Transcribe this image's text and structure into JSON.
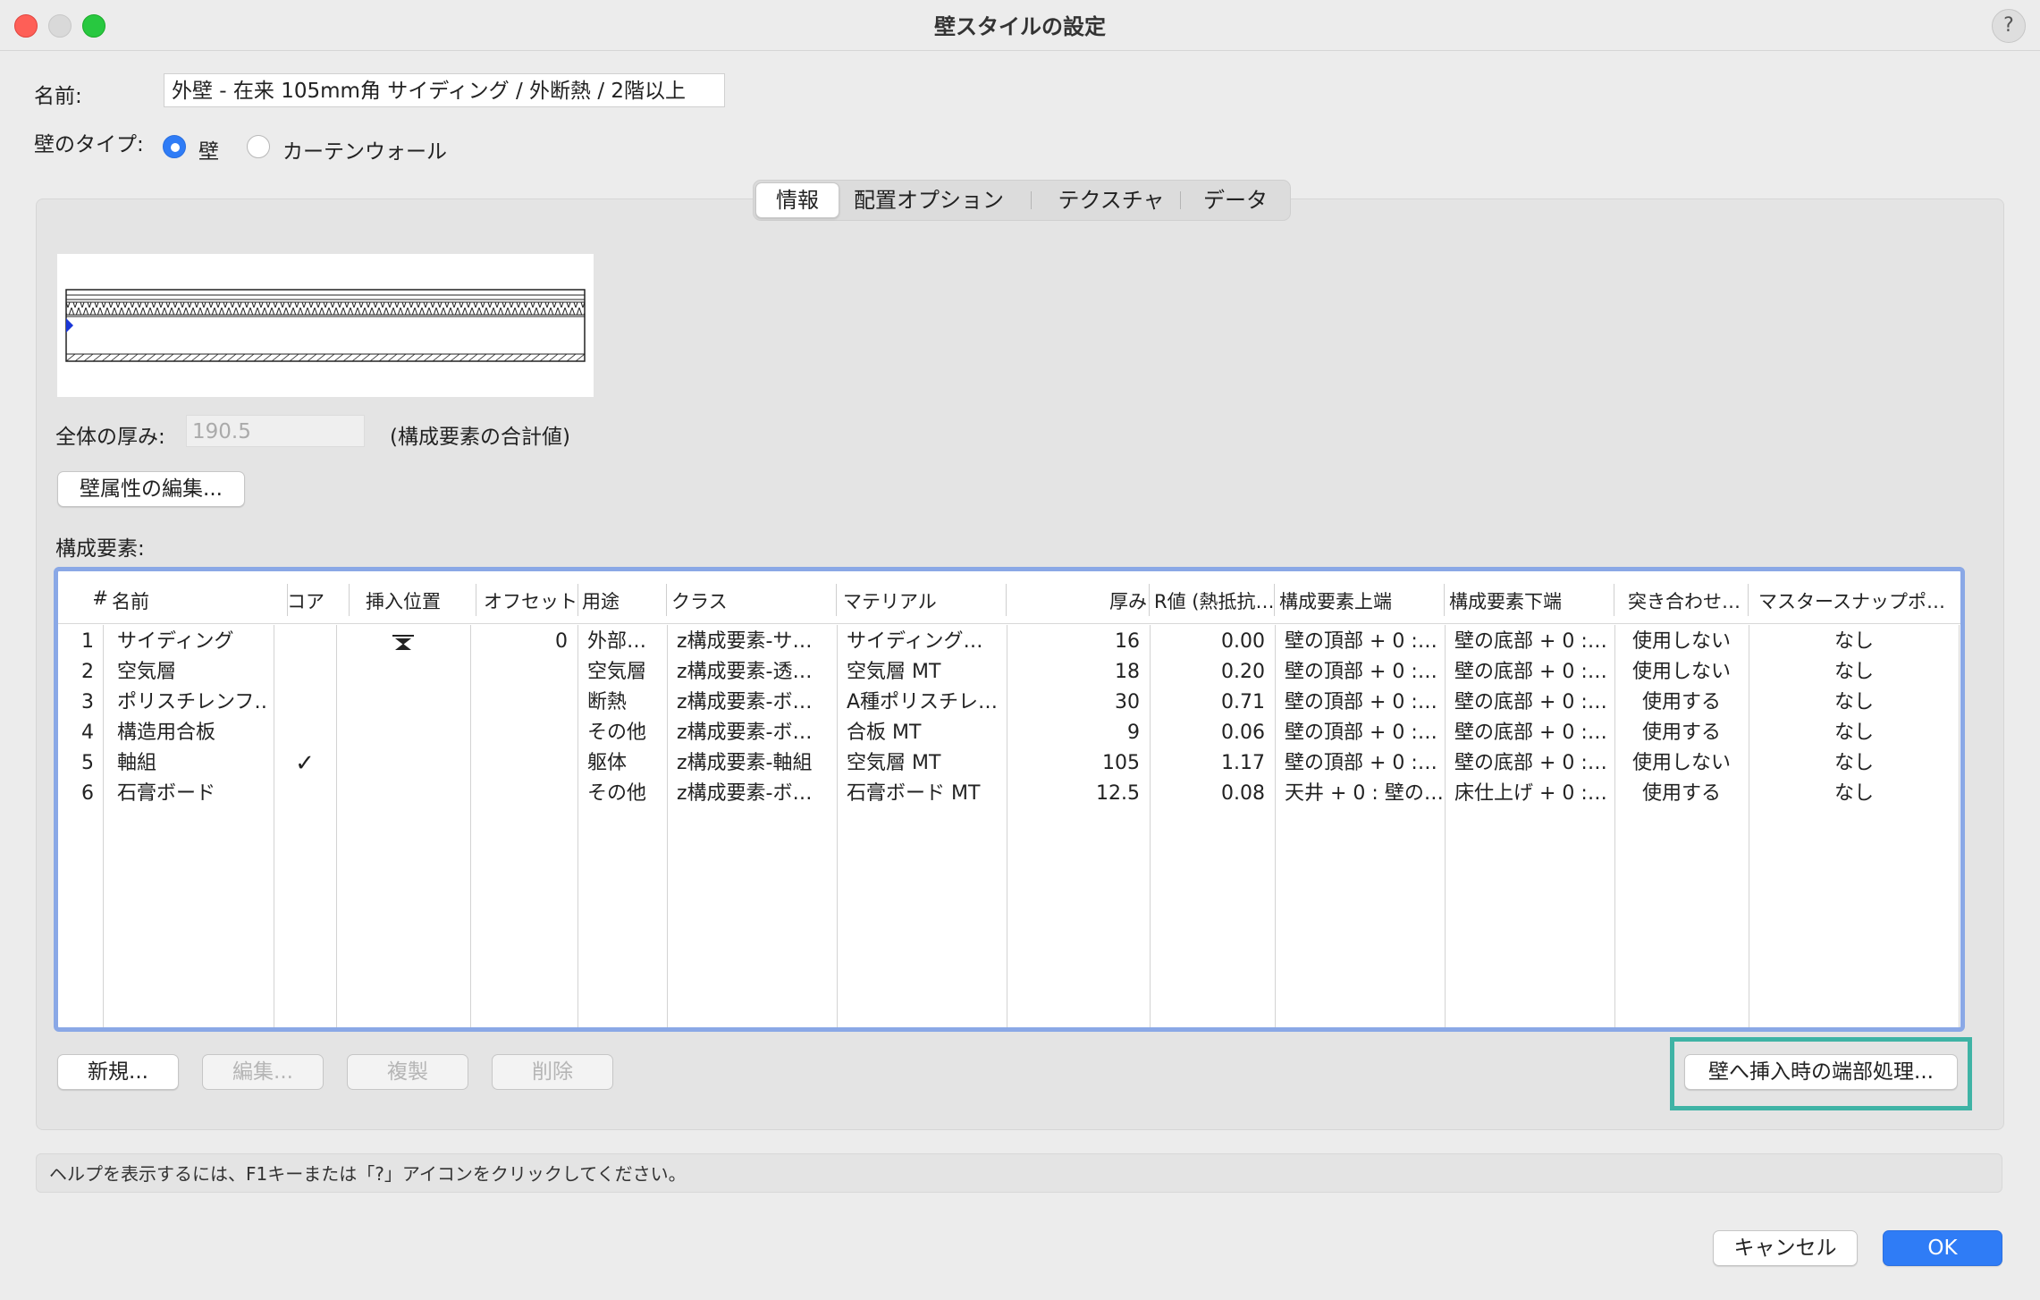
{
  "window": {
    "title": "壁スタイルの設定",
    "help": "?"
  },
  "name": {
    "label": "名前:",
    "value": "外壁 - 在来 105mm角 サイディング / 外断熱 / 2階以上"
  },
  "wall_type": {
    "label": "壁のタイプ:",
    "options": [
      "壁",
      "カーテンウォール"
    ],
    "selected": "壁"
  },
  "tabs": [
    {
      "label": "情報",
      "selected": true
    },
    {
      "label": "配置オプション"
    },
    {
      "label": "テクスチャ"
    },
    {
      "label": "データ"
    }
  ],
  "thickness": {
    "label": "全体の厚み:",
    "value": "190.5",
    "note": "(構成要素の合計値)"
  },
  "edit_attrs_label": "壁属性の編集...",
  "components_label": "構成要素:",
  "table": {
    "headers": [
      "#",
      "名前",
      "コア",
      "挿入位置",
      "オフセット",
      "用途",
      "クラス",
      "マテリアル",
      "厚み",
      "R値 (熱抵抗…",
      "構成要素上端",
      "構成要素下端",
      "突き合わせ…",
      "マスタースナップポ…"
    ],
    "rows": [
      {
        "num": "1",
        "name": "サイディング",
        "core": "",
        "insert_icon": "insert-position-icon",
        "offset": "0",
        "use": "外部…",
        "class": "z構成要素-サ…",
        "material": "サイディング…",
        "thickness": "16",
        "r": "0.00",
        "top": "壁の頂部 + 0 :…",
        "bottom": "壁の底部 + 0 :…",
        "butt": "使用しない",
        "snap": "なし"
      },
      {
        "num": "2",
        "name": "空気層",
        "core": "",
        "offset": "",
        "use": "空気層",
        "class": "z構成要素-透…",
        "material": "空気層 MT",
        "thickness": "18",
        "r": "0.20",
        "top": "壁の頂部 + 0 :…",
        "bottom": "壁の底部 + 0 :…",
        "butt": "使用しない",
        "snap": "なし"
      },
      {
        "num": "3",
        "name": "ポリスチレンフ…",
        "core": "",
        "offset": "",
        "use": "断熱",
        "class": "z構成要素-ボ…",
        "material": "A種ポリスチレ…",
        "thickness": "30",
        "r": "0.71",
        "top": "壁の頂部 + 0 :…",
        "bottom": "壁の底部 + 0 :…",
        "butt": "使用する",
        "snap": "なし"
      },
      {
        "num": "4",
        "name": "構造用合板",
        "core": "",
        "offset": "",
        "use": "その他",
        "class": "z構成要素-ボ…",
        "material": "合板 MT",
        "thickness": "9",
        "r": "0.06",
        "top": "壁の頂部 + 0 :…",
        "bottom": "壁の底部 + 0 :…",
        "butt": "使用する",
        "snap": "なし"
      },
      {
        "num": "5",
        "name": "軸組",
        "core": "✓",
        "offset": "",
        "use": "躯体",
        "class": "z構成要素-軸組",
        "material": "空気層 MT",
        "thickness": "105",
        "r": "1.17",
        "top": "壁の頂部 + 0 :…",
        "bottom": "壁の底部 + 0 :…",
        "butt": "使用しない",
        "snap": "なし"
      },
      {
        "num": "6",
        "name": "石膏ボード",
        "core": "",
        "offset": "",
        "use": "その他",
        "class": "z構成要素-ボ…",
        "material": "石膏ボード MT",
        "thickness": "12.5",
        "r": "0.08",
        "top": "天井 + 0 : 壁の…",
        "bottom": "床仕上げ + 0 :…",
        "butt": "使用する",
        "snap": "なし"
      }
    ]
  },
  "buttons": {
    "new": "新規...",
    "edit": "編集...",
    "duplicate": "複製",
    "delete": "削除",
    "end_treatment": "壁へ挿入時の端部処理..."
  },
  "status": "ヘルプを表示するには、F1キーまたは「?」アイコンをクリックしてください。",
  "footer": {
    "cancel": "キャンセル",
    "ok": "OK"
  },
  "colors": {
    "accent": "#2f7cf6",
    "table_focus": "#8aa8e6",
    "highlight": "#3fb3a5"
  }
}
